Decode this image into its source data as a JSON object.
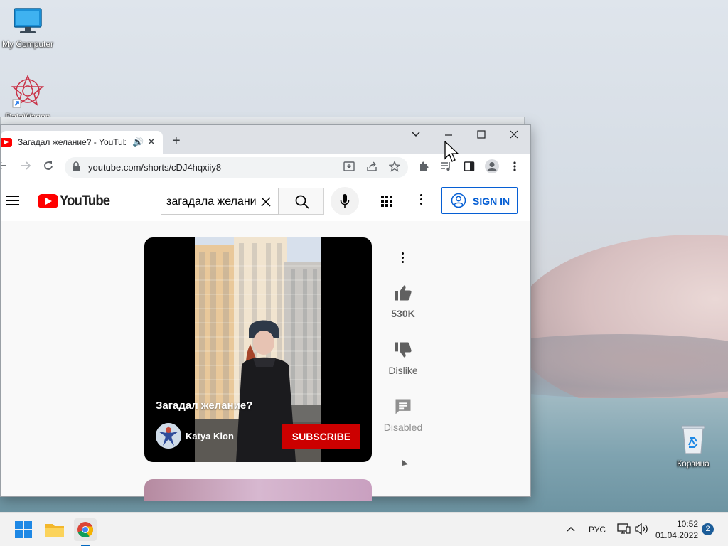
{
  "desktop": {
    "icons": [
      {
        "label": "My Computer"
      },
      {
        "label": "DataWagon"
      },
      {
        "label": "Корзина"
      }
    ]
  },
  "browser": {
    "tab": {
      "title": "Загадал желание? - YouTube"
    },
    "url": "youtube.com/shorts/cDJ4hqxiiy8"
  },
  "youtube": {
    "logo_text": "YouTube",
    "search_value": "загадала желани",
    "sign_in": "SIGN IN",
    "short": {
      "title": "Загадал желание?",
      "channel": "Katya Klon",
      "subscribe": "SUBSCRIBE"
    },
    "actions": {
      "likes": "530K",
      "dislike": "Dislike",
      "comments": "Disabled"
    }
  },
  "taskbar": {
    "language": "РУС",
    "time": "10:52",
    "date": "01.04.2022",
    "notifications": "2"
  },
  "colors": {
    "youtube_red": "#ff0000",
    "subscribe_red": "#cc0000",
    "signin_blue": "#065fd4"
  }
}
